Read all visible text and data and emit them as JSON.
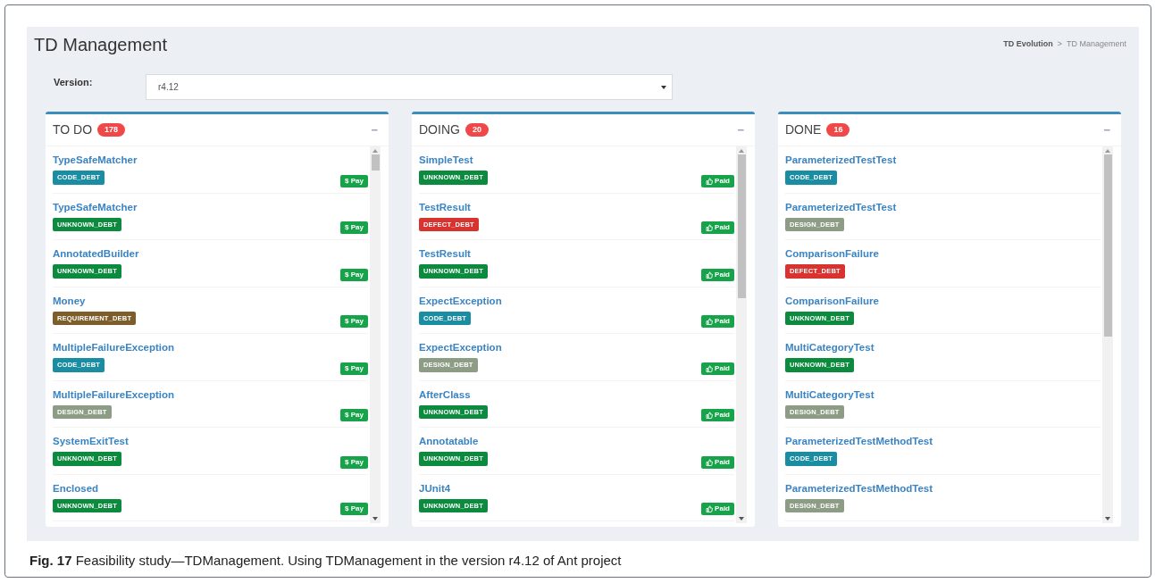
{
  "page": {
    "title": "TD Management",
    "breadcrumb": [
      "TD Evolution",
      "TD Management"
    ],
    "breadcrumb_separator": ">"
  },
  "version": {
    "label": "Version:",
    "value": "r4.12"
  },
  "columns": [
    {
      "title": "TO DO",
      "count": "178",
      "collapse": "−",
      "kind": "pay",
      "items": [
        {
          "name": "TypeSafeMatcher",
          "tag": "CODE_DEBT",
          "color": "#1b8da3",
          "action": "$ Pay"
        },
        {
          "name": "TypeSafeMatcher",
          "tag": "UNKNOWN_DEBT",
          "color": "#0c8a3e",
          "action": "$ Pay"
        },
        {
          "name": "AnnotatedBuilder",
          "tag": "UNKNOWN_DEBT",
          "color": "#0c8a3e",
          "action": "$ Pay"
        },
        {
          "name": "Money",
          "tag": "REQUIREMENT_DEBT",
          "color": "#7d5e2a",
          "action": "$ Pay"
        },
        {
          "name": "MultipleFailureException",
          "tag": "CODE_DEBT",
          "color": "#1b8da3",
          "action": "$ Pay"
        },
        {
          "name": "MultipleFailureException",
          "tag": "DESIGN_DEBT",
          "color": "#8c9c85",
          "action": "$ Pay"
        },
        {
          "name": "SystemExitTest",
          "tag": "UNKNOWN_DEBT",
          "color": "#0c8a3e",
          "action": "$ Pay"
        },
        {
          "name": "Enclosed",
          "tag": "UNKNOWN_DEBT",
          "color": "#0c8a3e",
          "action": "$ Pay"
        }
      ]
    },
    {
      "title": "DOING",
      "count": "20",
      "collapse": "−",
      "kind": "paid",
      "items": [
        {
          "name": "SimpleTest",
          "tag": "UNKNOWN_DEBT",
          "color": "#0c8a3e",
          "action": "Paid"
        },
        {
          "name": "TestResult",
          "tag": "DEFECT_DEBT",
          "color": "#d8332f",
          "action": "Paid"
        },
        {
          "name": "TestResult",
          "tag": "UNKNOWN_DEBT",
          "color": "#0c8a3e",
          "action": "Paid"
        },
        {
          "name": "ExpectException",
          "tag": "CODE_DEBT",
          "color": "#1b8da3",
          "action": "Paid"
        },
        {
          "name": "ExpectException",
          "tag": "DESIGN_DEBT",
          "color": "#8c9c85",
          "action": "Paid"
        },
        {
          "name": "AfterClass",
          "tag": "UNKNOWN_DEBT",
          "color": "#0c8a3e",
          "action": "Paid"
        },
        {
          "name": "Annotatable",
          "tag": "UNKNOWN_DEBT",
          "color": "#0c8a3e",
          "action": "Paid"
        },
        {
          "name": "JUnit4",
          "tag": "UNKNOWN_DEBT",
          "color": "#0c8a3e",
          "action": "Paid"
        }
      ]
    },
    {
      "title": "DONE",
      "count": "16",
      "collapse": "−",
      "items": [
        {
          "name": "ParameterizedTestTest",
          "tag": "CODE_DEBT",
          "color": "#1b8da3"
        },
        {
          "name": "ParameterizedTestTest",
          "tag": "DESIGN_DEBT",
          "color": "#8c9c85"
        },
        {
          "name": "ComparisonFailure",
          "tag": "DEFECT_DEBT",
          "color": "#d8332f"
        },
        {
          "name": "ComparisonFailure",
          "tag": "UNKNOWN_DEBT",
          "color": "#0c8a3e"
        },
        {
          "name": "MultiCategoryTest",
          "tag": "UNKNOWN_DEBT",
          "color": "#0c8a3e"
        },
        {
          "name": "MultiCategoryTest",
          "tag": "DESIGN_DEBT",
          "color": "#8c9c85"
        },
        {
          "name": "ParameterizedTestMethodTest",
          "tag": "CODE_DEBT",
          "color": "#1b8da3"
        },
        {
          "name": "ParameterizedTestMethodTest",
          "tag": "DESIGN_DEBT",
          "color": "#8c9c85"
        }
      ]
    }
  ],
  "caption": "**Fig. 17** Feasibility study—TDManagement. Using TDManagement in the version r4.12 of Ant project"
}
